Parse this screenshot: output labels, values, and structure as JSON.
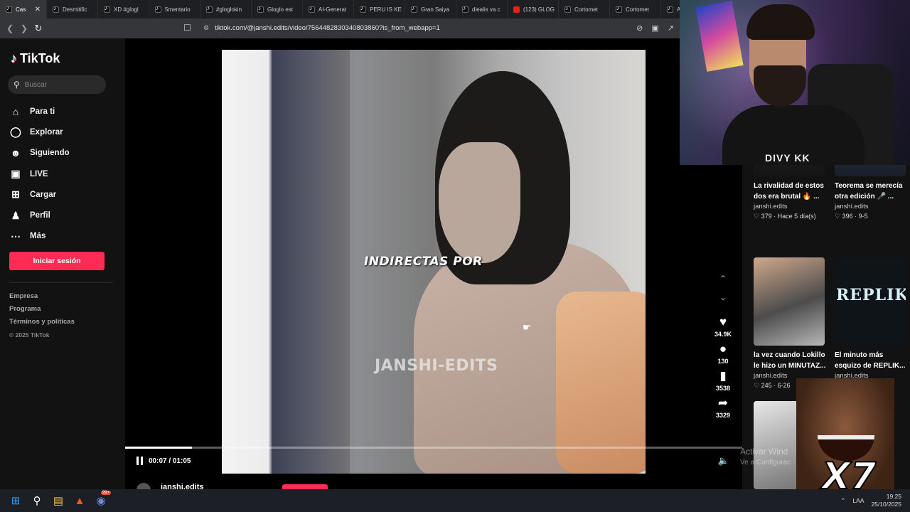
{
  "browser": {
    "tabs": [
      {
        "label": "Cas",
        "active": true,
        "icon": "tiktok-icon"
      },
      {
        "label": "Desmitific",
        "icon": "tiktok-icon"
      },
      {
        "label": "XD #glogl",
        "icon": "tiktok-icon"
      },
      {
        "label": "5mentario",
        "icon": "tiktok-icon"
      },
      {
        "label": "#gloglokin",
        "icon": "tiktok-icon"
      },
      {
        "label": "Gloglo est",
        "icon": "tiktok-icon"
      },
      {
        "label": "AI-Generat",
        "icon": "tiktok-icon"
      },
      {
        "label": "PERU IS KE",
        "icon": "tiktok-icon"
      },
      {
        "label": "Gran Saiya",
        "icon": "tiktok-icon"
      },
      {
        "label": "diealis va c",
        "icon": "tiktok-icon"
      },
      {
        "label": "(123) GLOG",
        "icon": "youtube-icon"
      },
      {
        "label": "Cortomet",
        "icon": "tiktok-icon"
      },
      {
        "label": "Cortomet",
        "icon": "tiktok-icon"
      },
      {
        "label": "A",
        "icon": "tiktok-icon"
      }
    ],
    "url": "tiktok.com/@janshi.edits/video/7564482830340803860?is_from_webapp=1"
  },
  "sidebar": {
    "logo": "TikTok",
    "search_placeholder": "Buscar",
    "nav": [
      {
        "label": "Para ti",
        "icon": "home-icon"
      },
      {
        "label": "Explorar",
        "icon": "compass-icon"
      },
      {
        "label": "Siguiendo",
        "icon": "following-icon"
      },
      {
        "label": "LIVE",
        "icon": "live-icon"
      },
      {
        "label": "Cargar",
        "icon": "upload-icon"
      },
      {
        "label": "Perfil",
        "icon": "profile-icon"
      },
      {
        "label": "Más",
        "icon": "more-icon"
      }
    ],
    "login_label": "Iniciar sesión",
    "footer": [
      "Empresa",
      "Programa",
      "Términos y políticas"
    ],
    "copyright": "© 2025 TikTok"
  },
  "video": {
    "overlay_text": "INDIRECTAS POR",
    "watermark": "JANSHI-EDITS",
    "time": "00:07 / 01:05",
    "progress": 0.108,
    "likes": "34.9K",
    "comments": "130",
    "saves": "3538",
    "shares": "3329",
    "author": "janshi.edits"
  },
  "related": [
    {
      "title": "La rivalidad de estos dos era brutal 🔥 ...",
      "author": "janshi.edits",
      "meta": "♡ 379 · Hace 5 día(s)"
    },
    {
      "title": "Teorema se merecía otra edición 🎤 ...",
      "author": "janshi.edits",
      "meta": "♡ 396 · 9-5"
    },
    {
      "title": "la vez cuando Lokillo le hizo un MINUTAZ...",
      "author": "janshi.edits",
      "meta": "♡ 245 · 6-26"
    },
    {
      "title": "El minuto más esquizo de REPLIK...",
      "author": "janshi.edits",
      "meta": ""
    }
  ],
  "related_thumb_text": "REPLIK",
  "windows_notice": {
    "line1": "Activar Wind",
    "line2": "Ve a Configurac"
  },
  "stream": {
    "cam_brand": "DIVY KK",
    "meme_text": "X7"
  },
  "taskbar": {
    "lang": "LAA",
    "time": "19:25",
    "date": "25/10/2025",
    "discord_badge": "99+"
  }
}
